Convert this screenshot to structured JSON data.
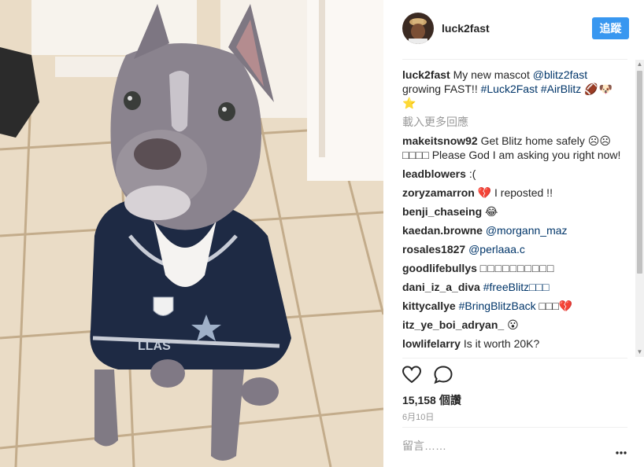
{
  "post": {
    "username": "luck2fast",
    "follow_label": "追蹤",
    "caption": {
      "user": "luck2fast",
      "text_a": "My new mascot ",
      "mention": "@blitz2fast",
      "text_b": " growing FAST!! ",
      "tag1": "#Luck2Fast",
      "tag2": "#AirBlitz",
      "emoji": "🏈🐶⭐"
    },
    "load_more": "載入更多回應",
    "comments": [
      {
        "user": "makeitsnow92",
        "text": "Get Blitz home safely ☹☹ □□□□ Please God I am asking you right now!"
      },
      {
        "user": "leadblowers",
        "text": ":("
      },
      {
        "user": "zoryzamarron",
        "text": "💔 I reposted !!"
      },
      {
        "user": "benji_chaseing",
        "text": "😂"
      },
      {
        "user": "kaedan.browne",
        "mention": "@morgann_maz"
      },
      {
        "user": "rosales1827",
        "mention": "@perlaaa.c"
      },
      {
        "user": "goodlifebullys",
        "text": "□□□□□□□□□□"
      },
      {
        "user": "dani_iz_a_diva",
        "mention": "#freeBlitz□□□"
      },
      {
        "user": "kittycallye",
        "mention": "#BringBlitzBack",
        "text": "□□□💔"
      },
      {
        "user": "itz_ye_boi_adryan_",
        "text": "😮"
      },
      {
        "user": "lowlifelarry",
        "text": "Is it worth 20K?"
      }
    ],
    "likes_count": "15,158",
    "likes_label": "個讚",
    "date": "6月10日",
    "add_comment_placeholder": "留言……"
  },
  "colors": {
    "accent": "#3897f0",
    "link": "#003569",
    "muted": "#999999"
  },
  "icons": [
    "heart-icon",
    "comment-icon",
    "more-options-icon"
  ]
}
